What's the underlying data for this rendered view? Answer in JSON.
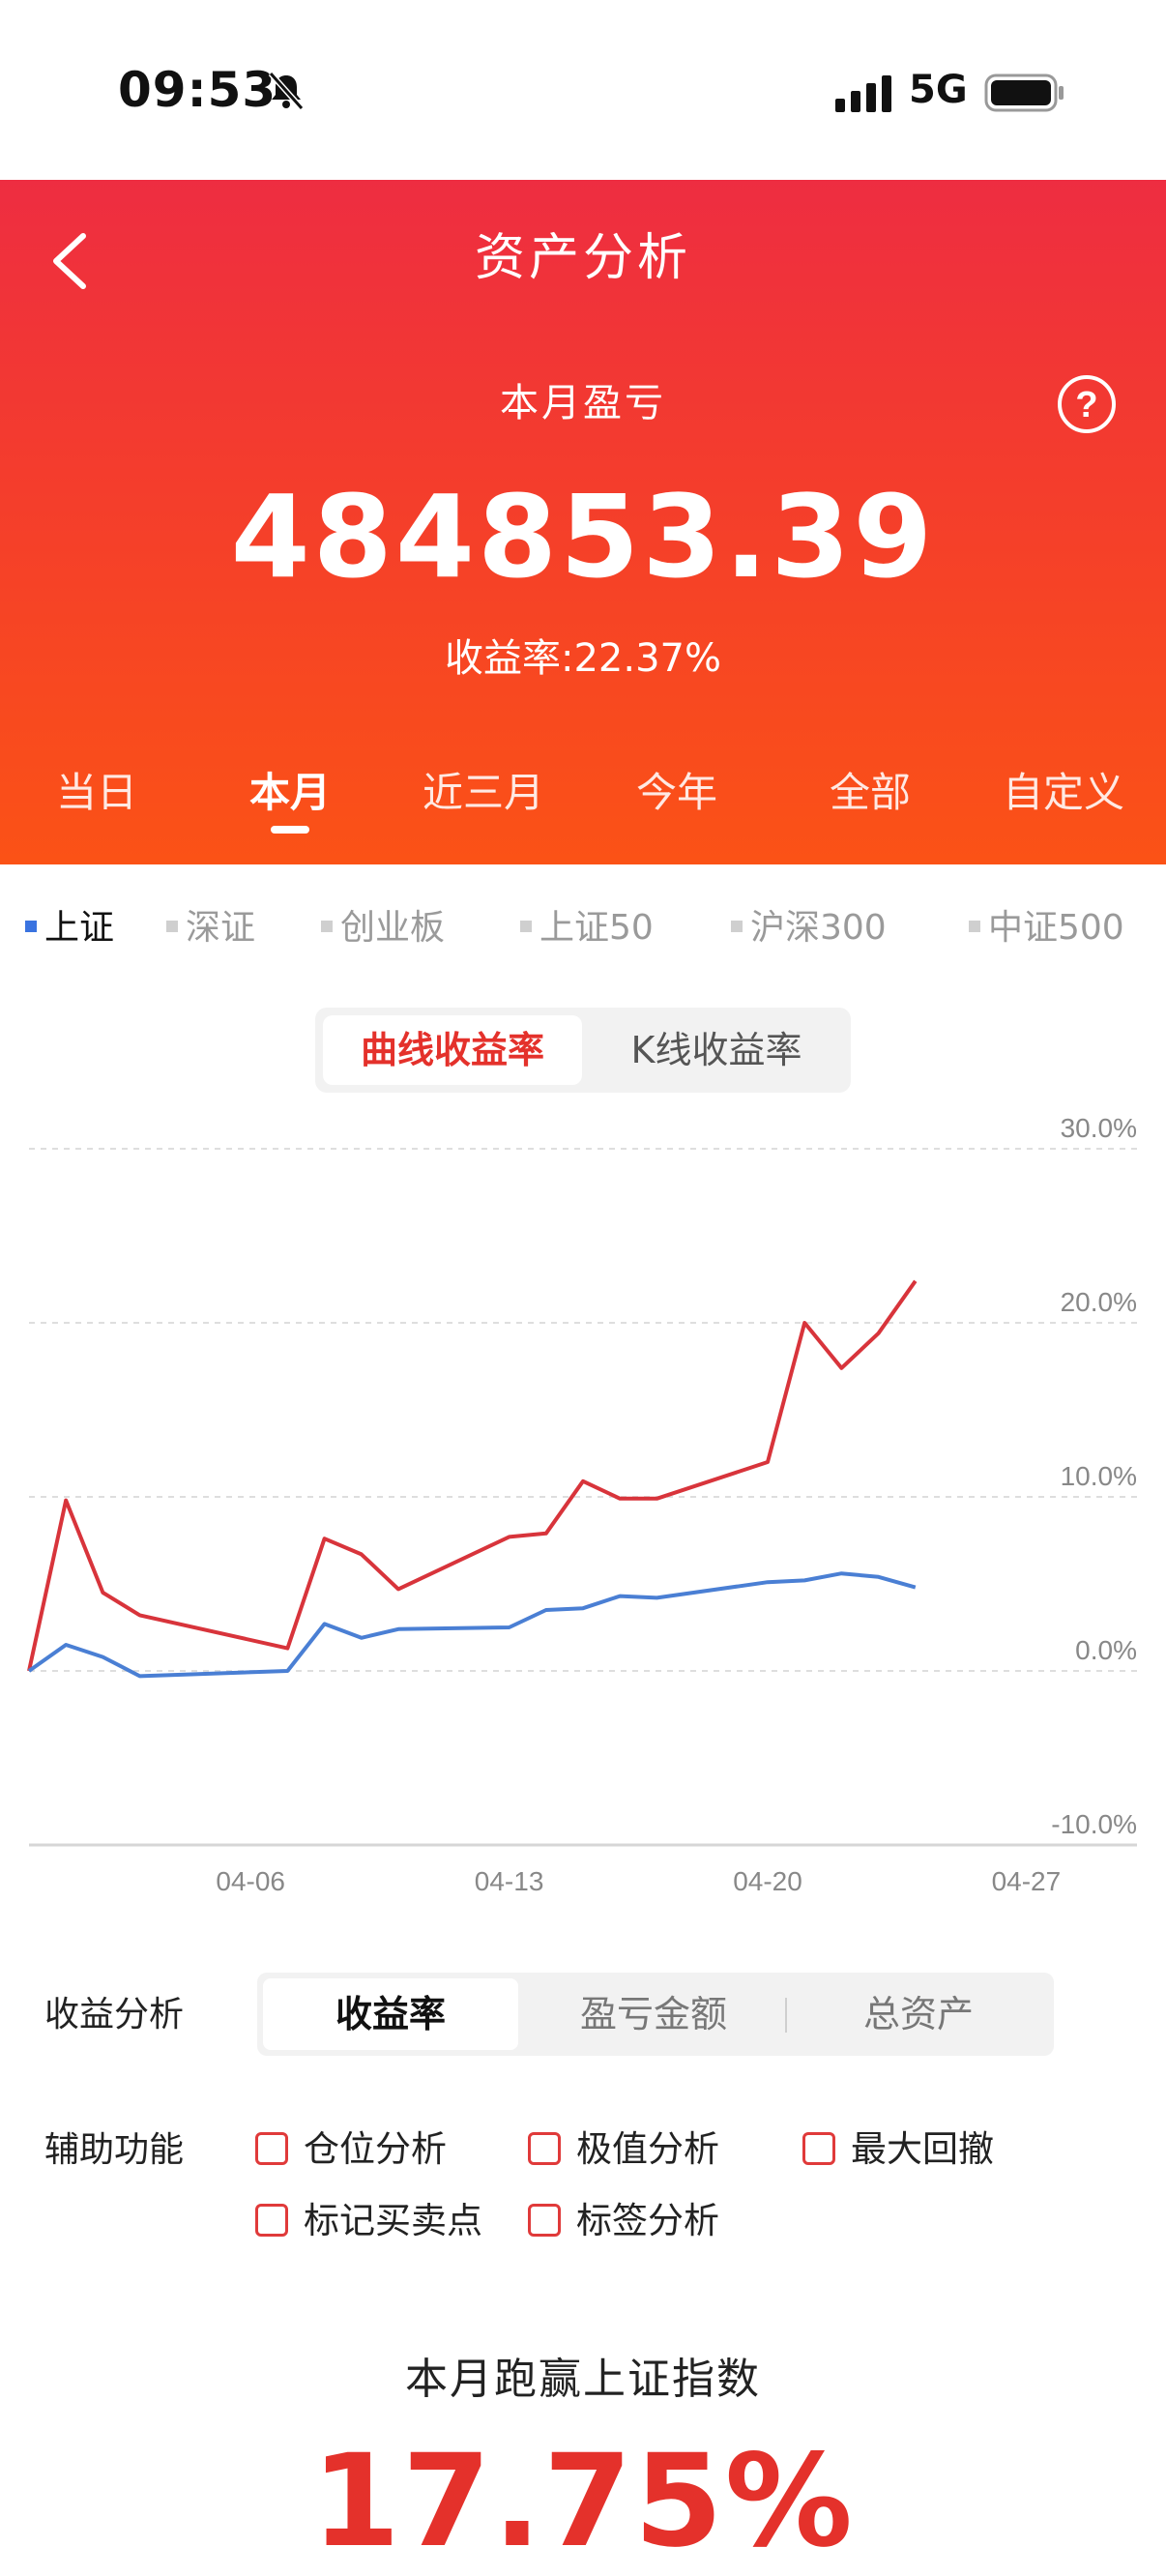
{
  "status_bar": {
    "time": "09:53",
    "network": "5G",
    "icons": [
      "bell-muted-icon",
      "signal-icon",
      "battery-icon"
    ]
  },
  "header": {
    "title": "资产分析",
    "month_label": "本月盈亏",
    "pnl_value": "484853.39",
    "return_text": "收益率:22.37%",
    "periods": [
      "当日",
      "本月",
      "近三月",
      "今年",
      "全部",
      "自定义"
    ],
    "active_period": "本月"
  },
  "indices": {
    "items": [
      "上证",
      "深证",
      "创业板",
      "上证50",
      "沪深300",
      "中证500"
    ],
    "active": "上证"
  },
  "chart_mode": {
    "options": [
      "曲线收益率",
      "K线收益率"
    ],
    "active": "曲线收益率"
  },
  "chart_data": {
    "type": "line",
    "x_tick_labels": [
      "04-06",
      "04-13",
      "04-20",
      "04-27"
    ],
    "y_tick_labels": [
      "30.0%",
      "20.0%",
      "10.0%",
      "0.0%",
      "-10.0%"
    ],
    "ylim": [
      -10,
      30
    ],
    "grid": true,
    "colors": {
      "portfolio": "#d8343b",
      "index": "#4a7fd4"
    },
    "x": [
      0,
      1,
      2,
      3,
      7,
      8,
      9,
      10,
      13,
      14,
      15,
      16,
      17,
      20,
      21,
      22,
      23,
      24
    ],
    "series": [
      {
        "values": [
          0.0,
          9.8,
          4.5,
          3.2,
          1.3,
          7.6,
          6.7,
          4.7,
          7.7,
          7.9,
          10.9,
          9.9,
          9.9,
          12.0,
          20.0,
          17.4,
          19.4,
          22.4
        ]
      },
      {
        "values": [
          0.0,
          1.5,
          0.8,
          -0.3,
          0.0,
          2.7,
          1.9,
          2.4,
          2.5,
          3.5,
          3.6,
          4.3,
          4.2,
          5.1,
          5.2,
          5.6,
          5.4,
          4.8
        ]
      }
    ]
  },
  "analysis": {
    "label": "收益分析",
    "tabs": [
      "收益率",
      "盈亏金额",
      "总资产"
    ],
    "active_tab": "收益率"
  },
  "aux": {
    "label": "辅助功能",
    "options": [
      "仓位分析",
      "极值分析",
      "最大回撤",
      "标记买卖点",
      "标签分析"
    ]
  },
  "beat": {
    "title": "本月跑赢上证指数",
    "value": "17.75%"
  }
}
